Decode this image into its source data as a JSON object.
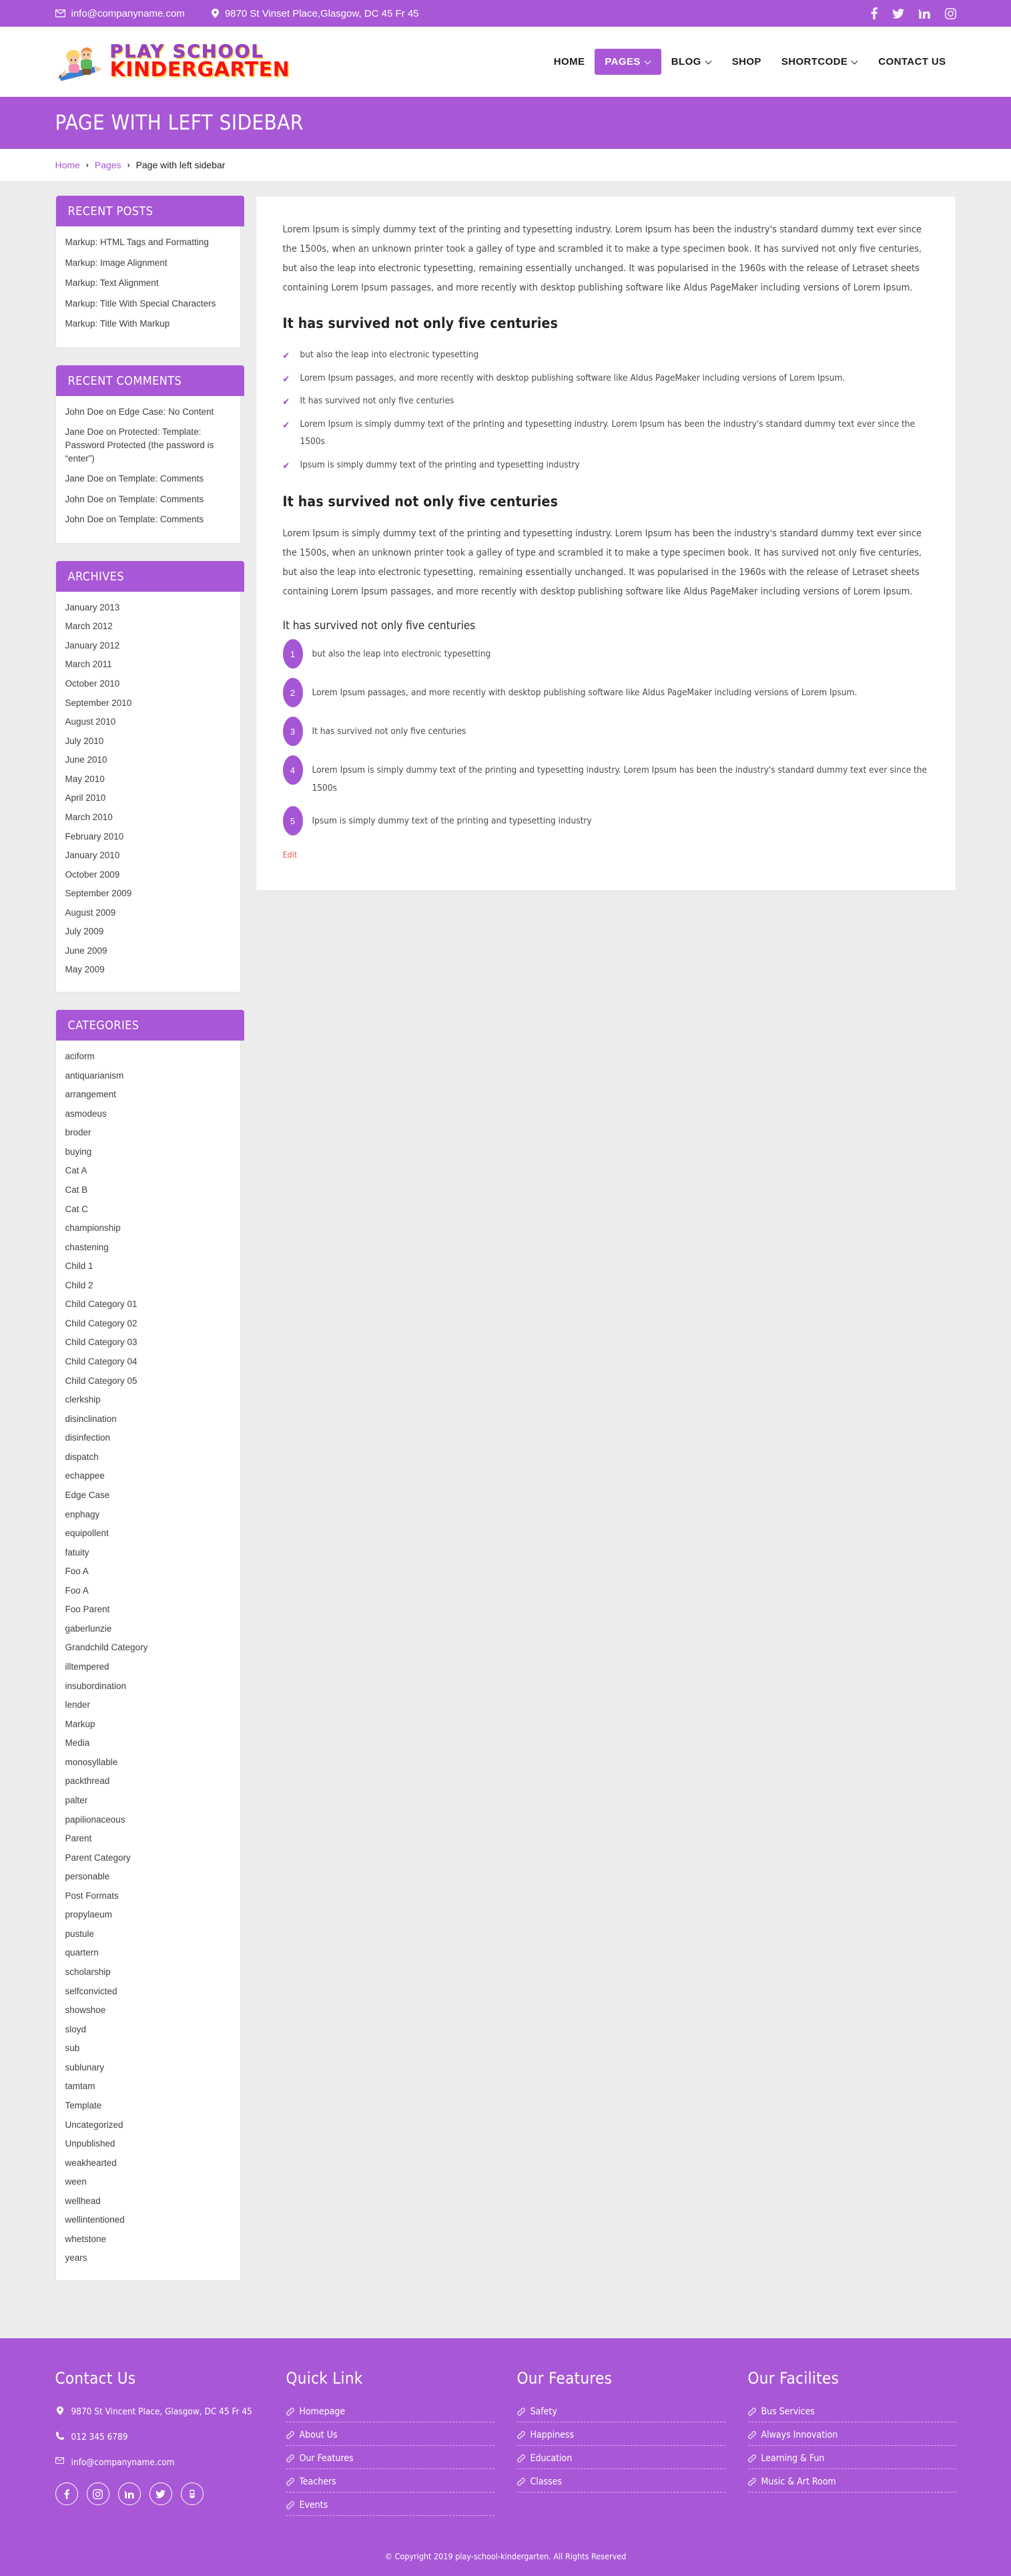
{
  "topbar": {
    "email": "info@companyname.com",
    "address": "9870 St Vinset Place,Glasgow, DC 45 Fr 45",
    "email_icon": "envelope-icon",
    "address_icon": "map-pin-icon",
    "social": [
      {
        "name": "facebook-icon",
        "label": "f"
      },
      {
        "name": "twitter-icon",
        "label": "t"
      },
      {
        "name": "linkedin-icon",
        "label": "in"
      },
      {
        "name": "instagram-icon",
        "label": "ig"
      }
    ]
  },
  "header": {
    "logo_line1": "PLAY SCHOOL",
    "logo_line2": "KINDERGARTEN",
    "nav": [
      {
        "label": "HOME",
        "has_caret": false,
        "active": false
      },
      {
        "label": "PAGES",
        "has_caret": true,
        "active": true
      },
      {
        "label": "BLOG",
        "has_caret": true,
        "active": false
      },
      {
        "label": "SHOP",
        "has_caret": false,
        "active": false
      },
      {
        "label": "SHORTCODE",
        "has_caret": true,
        "active": false
      },
      {
        "label": "CONTACT US",
        "has_caret": false,
        "active": false
      }
    ]
  },
  "page": {
    "title": "PAGE WITH LEFT SIDEBAR",
    "breadcrumb": {
      "home": "Home",
      "parent": "Pages",
      "current": "Page with left sidebar",
      "separator": "›"
    }
  },
  "sidebar": {
    "widgets": [
      {
        "title": "RECENT POSTS",
        "items": [
          "Markup: HTML Tags and Formatting",
          "Markup: Image Alignment",
          "Markup: Text Alignment",
          "Markup: Title With Special Characters",
          "Markup: Title With Markup"
        ]
      },
      {
        "title": "RECENT COMMENTS",
        "items": [
          "John Doe on Edge Case: No Content",
          "Jane Doe on Protected: Template: Password Protected (the password is “enter”)",
          "Jane Doe on Template: Comments",
          "John Doe on Template: Comments",
          "John Doe on Template: Comments"
        ]
      },
      {
        "title": "ARCHIVES",
        "items": [
          "January 2013",
          "March 2012",
          "January 2012",
          "March 2011",
          "October 2010",
          "September 2010",
          "August 2010",
          "July 2010",
          "June 2010",
          "May 2010",
          "April 2010",
          "March 2010",
          "February 2010",
          "January 2010",
          "October 2009",
          "September 2009",
          "August 2009",
          "July 2009",
          "June 2009",
          "May 2009"
        ]
      },
      {
        "title": "CATEGORIES",
        "items": [
          "aciform",
          "antiquarianism",
          "arrangement",
          "asmodeus",
          "broder",
          "buying",
          "Cat A",
          "Cat B",
          "Cat C",
          "championship",
          "chastening",
          "Child 1",
          "Child 2",
          "Child Category 01",
          "Child Category 02",
          "Child Category 03",
          "Child Category 04",
          "Child Category 05",
          "clerkship",
          "disinclination",
          "disinfection",
          "dispatch",
          "echappee",
          "Edge Case",
          "enphagy",
          "equipollent",
          "fatuity",
          "Foo A",
          "Foo A",
          "Foo Parent",
          "gaberlunzie",
          "Grandchild Category",
          "illtempered",
          "insubordination",
          "lender",
          "Markup",
          "Media",
          "monosyllable",
          "packthread",
          "palter",
          "papilionaceous",
          "Parent",
          "Parent Category",
          "personable",
          "Post Formats",
          "propylaeum",
          "pustule",
          "quartern",
          "scholarship",
          "selfconvicted",
          "showshoe",
          "sloyd",
          "sub",
          "sublunary",
          "tamtam",
          "Template",
          "Uncategorized",
          "Unpublished",
          "weakhearted",
          "ween",
          "wellhead",
          "wellintentioned",
          "whetstone",
          "years"
        ]
      }
    ]
  },
  "main": {
    "intro_paragraph": "Lorem Ipsum is simply dummy text of the printing and typesetting industry. Lorem Ipsum has been the industry's standard dummy text ever since the 1500s, when an unknown printer took a galley of type and scrambled it to make a type specimen book. It has survived not only five centuries, but also the leap into electronic typesetting, remaining essentially unchanged. It was popularised in the 1960s with the release of Letraset sheets containing Lorem Ipsum passages, and more recently with desktop publishing software like Aldus PageMaker including versions of Lorem Ipsum.",
    "heading_1": "It has survived not only five centuries",
    "check_items": [
      "but also the leap into electronic typesetting",
      "Lorem Ipsum passages, and more recently with desktop publishing software like Aldus PageMaker including versions of Lorem Ipsum.",
      "It has survived not only five centuries",
      "Lorem Ipsum is simply dummy text of the printing and typesetting industry. Lorem Ipsum has been the industry's standard dummy text ever since the 1500s",
      "Ipsum is simply dummy text of the printing and typesetting industry"
    ],
    "heading_2": "It has survived not only five centuries",
    "second_paragraph": "Lorem Ipsum is simply dummy text of the printing and typesetting industry. Lorem Ipsum has been the industry's standard dummy text ever since the 1500s, when an unknown printer took a galley of type and scrambled it to make a type specimen book. It has survived not only five centuries, but also the leap into electronic typesetting, remaining essentially unchanged. It was popularised in the 1960s with the release of Letraset sheets containing Lorem Ipsum passages, and more recently with desktop publishing software like Aldus PageMaker including versions of Lorem Ipsum.",
    "heading_3": "It has survived not only five centuries",
    "numbered_items": [
      {
        "num": "1",
        "text": "but also the leap into electronic typesetting"
      },
      {
        "num": "2",
        "text": "Lorem Ipsum passages, and more recently with desktop publishing software like Aldus PageMaker including versions of Lorem Ipsum."
      },
      {
        "num": "3",
        "text": "It has survived not only five centuries"
      },
      {
        "num": "4",
        "text": "Lorem Ipsum is simply dummy text of the printing and typesetting industry. Lorem Ipsum has been the industry's standard dummy text ever since the 1500s"
      },
      {
        "num": "5",
        "text": "Ipsum is simply dummy text of the printing and typesetting industry"
      }
    ],
    "edit_label": "Edit",
    "check_glyph": "✔"
  },
  "footer": {
    "contact": {
      "title": "Contact Us",
      "address": "9870 St Vincent Place, Glasgow, DC 45 Fr 45",
      "phone": "012 345 6789",
      "email": "info@companyname.com",
      "social": [
        {
          "name": "facebook-icon"
        },
        {
          "name": "instagram-icon"
        },
        {
          "name": "linkedin-icon"
        },
        {
          "name": "twitter-icon"
        },
        {
          "name": "youtube-icon"
        }
      ]
    },
    "quick_link": {
      "title": "Quick Link",
      "items": [
        "Homepage",
        "About Us",
        "Our Features",
        "Teachers",
        "Events"
      ]
    },
    "our_features": {
      "title": "Our Features",
      "items": [
        "Safety",
        "Happiness",
        "Education",
        "Classes"
      ]
    },
    "our_facilities": {
      "title": "Our Facilites",
      "items": [
        "Bus Services",
        "Always Innovation",
        "Learning & Fun",
        "Music & Art Room"
      ]
    },
    "copyright": "© Copyright 2019 play-school-kindergarten. All Rights Reserved"
  },
  "colors": {
    "brand_purple": "#a858d6",
    "accent_red": "#e2574c",
    "logo_red": "#fb1111",
    "logo_purple": "#9b40c6"
  }
}
